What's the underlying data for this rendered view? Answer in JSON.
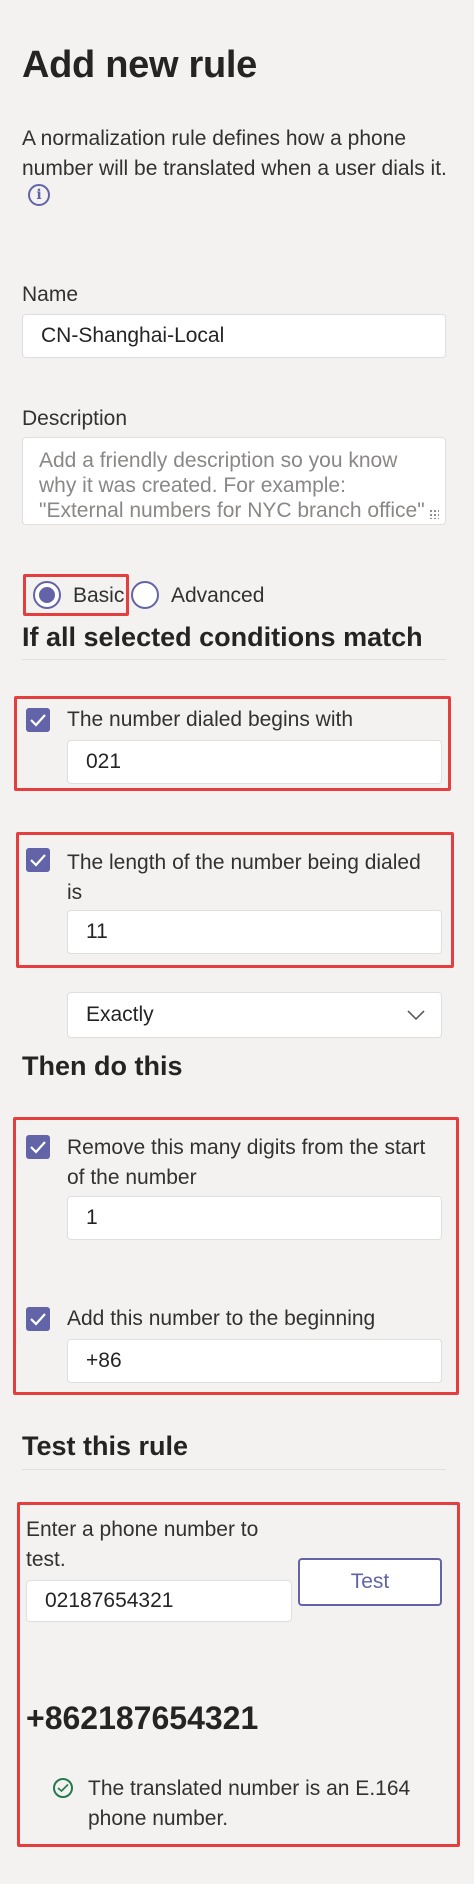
{
  "header": {
    "title": "Add new rule",
    "intro_line1": "A normalization rule defines how a phone",
    "intro_line2": "number will be translated when a user dials it."
  },
  "name": {
    "label": "Name",
    "value": "CN-Shanghai-Local"
  },
  "description": {
    "label": "Description",
    "placeholder_line1": "Add a friendly description so you know",
    "placeholder_line2": "why it was created. For example:",
    "placeholder_line3": "\"External numbers for NYC branch office\""
  },
  "mode": {
    "basic_label": "Basic",
    "advanced_label": "Advanced",
    "selected": "Basic"
  },
  "conditions": {
    "heading": "If all selected conditions match",
    "begins_with": {
      "label": "The number dialed begins with",
      "value": "021",
      "checked": true
    },
    "length": {
      "label_line1": "The length of the number being dialed",
      "label_line2": "is",
      "value": "11",
      "checked": true,
      "match": "Exactly"
    }
  },
  "actions": {
    "heading": "Then do this",
    "remove_digits": {
      "label_line1": "Remove this many digits from the start",
      "label_line2": "of the number",
      "value": "1",
      "checked": true
    },
    "add_prefix": {
      "label": "Add this number to the beginning",
      "value": "+86",
      "checked": true
    }
  },
  "test": {
    "heading": "Test this rule",
    "prompt_line1": "Enter a phone number to",
    "prompt_line2": "test.",
    "input_value": "02187654321",
    "button_label": "Test",
    "result": "+862187654321",
    "status_line1": "The translated number is an E.164",
    "status_line2": "phone number."
  },
  "colors": {
    "accent": "#6264a7",
    "highlight": "#e53e3e",
    "success": "#237b4b"
  }
}
